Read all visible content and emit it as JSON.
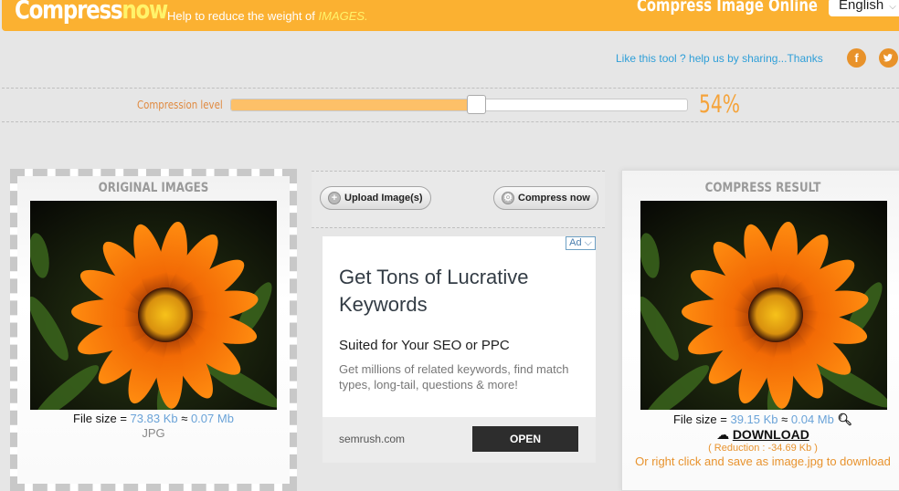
{
  "header": {
    "logo_part1": "Compress",
    "logo_part2": "now",
    "tagline_prefix": "Help to reduce the weight of ",
    "tagline_highlight": "IMAGES.",
    "site_title": "Compress Image Online",
    "language": "English"
  },
  "share": {
    "text": "Like this tool ? help us by sharing...Thanks",
    "icons": [
      {
        "name": "facebook-icon",
        "glyph": "f"
      },
      {
        "name": "twitter-icon",
        "glyph": "t"
      }
    ]
  },
  "compression": {
    "label": "Compression level",
    "value_percent": 54,
    "display": "54%"
  },
  "original": {
    "title": "ORIGINAL IMAGES",
    "file_size_label": "File size = ",
    "size_kb": "73.83 Kb",
    "approx": " ≈ ",
    "size_mb": "0.07 Mb",
    "format": "JPG"
  },
  "actions": {
    "upload_label": "Upload Image(s)",
    "compress_label": "Compress now"
  },
  "ad": {
    "badge": "Ad",
    "headline": "Get Tons of Lucrative Keywords",
    "subheadline": "Suited for Your SEO or PPC",
    "body": "Get millions of related keywords, find match types, long-tail, questions & more!",
    "domain": "semrush.com",
    "cta": "OPEN"
  },
  "result": {
    "title": "COMPRESS RESULT",
    "file_size_label": "File size = ",
    "size_kb": "39.15 Kb",
    "approx": " ≈ ",
    "size_mb": "0.04 Mb",
    "download_label": "DOWNLOAD",
    "reduction": "( Reduction : -34.69 Kb )",
    "save_hint": "Or right click and save as image.jpg to download"
  },
  "colors": {
    "brand_orange": "#fbb131",
    "accent_yellow": "#fff36a",
    "slider_fill": "#fdc068",
    "link_blue": "#2f9fd8"
  }
}
